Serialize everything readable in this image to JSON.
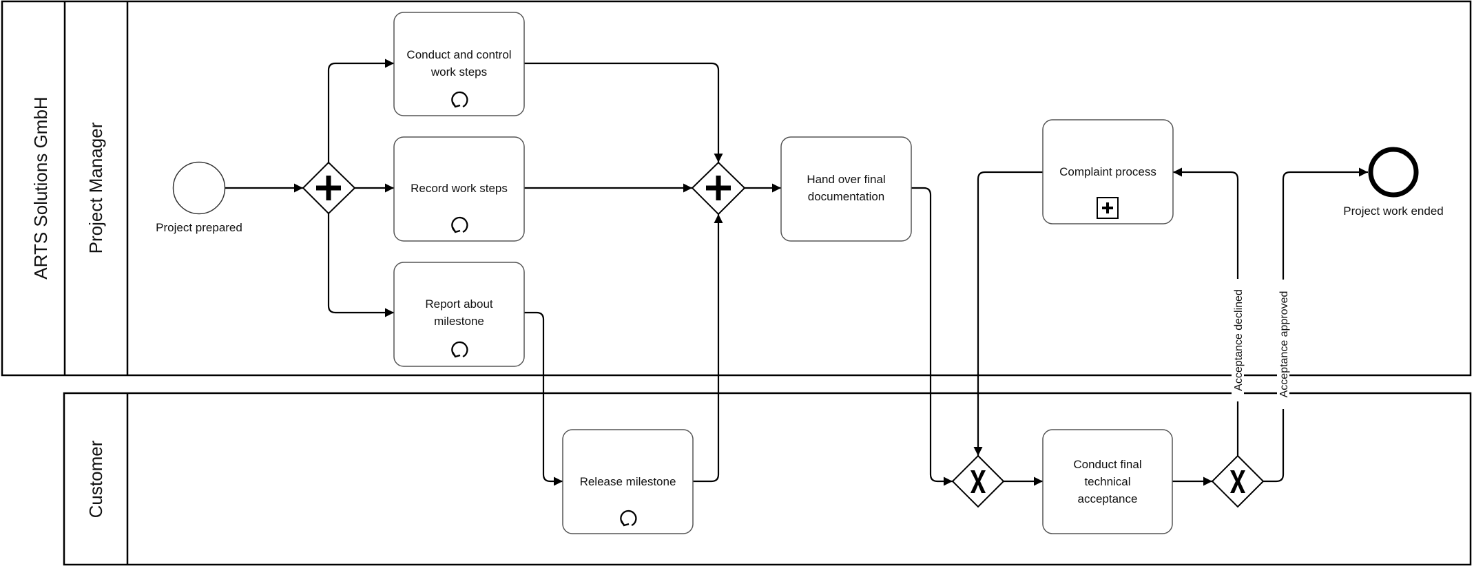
{
  "diagram": {
    "type": "BPMN collaboration",
    "pools": [
      {
        "id": "pool-arts",
        "label": "ARTS Solutions GmbH",
        "lanes": [
          {
            "id": "lane-pm",
            "label": "Project Manager"
          }
        ]
      },
      {
        "id": "pool-customer",
        "label": "Customer",
        "lanes": []
      }
    ],
    "events": [
      {
        "id": "start",
        "kind": "start",
        "label": "Project prepared",
        "lane": "Project Manager"
      },
      {
        "id": "end",
        "kind": "end",
        "label": "Project work ended",
        "lane": "Project Manager"
      }
    ],
    "tasks": [
      {
        "id": "t-conduct",
        "label_lines": [
          "Conduct and control",
          "work steps"
        ],
        "marker": "loop",
        "lane": "Project Manager"
      },
      {
        "id": "t-record",
        "label_lines": [
          "Record work steps"
        ],
        "marker": "loop",
        "lane": "Project Manager"
      },
      {
        "id": "t-report",
        "label_lines": [
          "Report about",
          "milestone"
        ],
        "marker": "loop",
        "lane": "Project Manager"
      },
      {
        "id": "t-handover",
        "label_lines": [
          "Hand over final",
          "documentation"
        ],
        "marker": "",
        "lane": "Project Manager"
      },
      {
        "id": "t-complaint",
        "label_lines": [
          "Complaint process"
        ],
        "marker": "collapsed-subprocess",
        "lane": "Project Manager"
      },
      {
        "id": "t-release",
        "label_lines": [
          "Release milestone"
        ],
        "marker": "loop",
        "lane": "Customer"
      },
      {
        "id": "t-acceptance",
        "label_lines": [
          "Conduct final",
          "technical",
          "acceptance"
        ],
        "marker": "",
        "lane": "Customer"
      }
    ],
    "gateways": [
      {
        "id": "g-split",
        "kind": "parallel",
        "symbol": "+"
      },
      {
        "id": "g-join",
        "kind": "parallel",
        "symbol": "+"
      },
      {
        "id": "g-merge",
        "kind": "exclusive",
        "symbol": "X"
      },
      {
        "id": "g-decision",
        "kind": "exclusive",
        "symbol": "X"
      }
    ],
    "flows": [
      {
        "from": "start",
        "to": "g-split",
        "label": ""
      },
      {
        "from": "g-split",
        "to": "t-conduct",
        "label": ""
      },
      {
        "from": "g-split",
        "to": "t-record",
        "label": ""
      },
      {
        "from": "g-split",
        "to": "t-report",
        "label": ""
      },
      {
        "from": "t-conduct",
        "to": "g-join",
        "label": ""
      },
      {
        "from": "t-record",
        "to": "g-join",
        "label": ""
      },
      {
        "from": "t-report",
        "to": "t-release",
        "label": ""
      },
      {
        "from": "t-release",
        "to": "g-join",
        "label": ""
      },
      {
        "from": "g-join",
        "to": "t-handover",
        "label": ""
      },
      {
        "from": "t-handover",
        "to": "g-merge",
        "label": ""
      },
      {
        "from": "t-complaint",
        "to": "g-merge",
        "label": ""
      },
      {
        "from": "g-merge",
        "to": "t-acceptance",
        "label": ""
      },
      {
        "from": "t-acceptance",
        "to": "g-decision",
        "label": ""
      },
      {
        "from": "g-decision",
        "to": "t-complaint",
        "label": "Acceptance declined"
      },
      {
        "from": "g-decision",
        "to": "end",
        "label": "Acceptance approved"
      }
    ]
  },
  "labels": {
    "pool_arts": "ARTS Solutions GmbH",
    "lane_pm": "Project Manager",
    "pool_customer": "Customer",
    "start_event": "Project prepared",
    "end_event": "Project work ended",
    "task_conduct_1": "Conduct and control",
    "task_conduct_2": "work steps",
    "task_record": "Record work steps",
    "task_report_1": "Report about",
    "task_report_2": "milestone",
    "task_handover_1": "Hand over final",
    "task_handover_2": "documentation",
    "task_complaint": "Complaint process",
    "task_release": "Release milestone",
    "task_acceptance_1": "Conduct final",
    "task_acceptance_2": "technical",
    "task_acceptance_3": "acceptance",
    "flow_declined": "Acceptance declined",
    "flow_approved": "Acceptance approved"
  },
  "icons": {
    "loop": "loop-marker-icon",
    "subprocess": "collapsed-subprocess-plus-icon",
    "parallel": "parallel-gateway-plus-icon",
    "exclusive": "exclusive-gateway-x-icon"
  }
}
